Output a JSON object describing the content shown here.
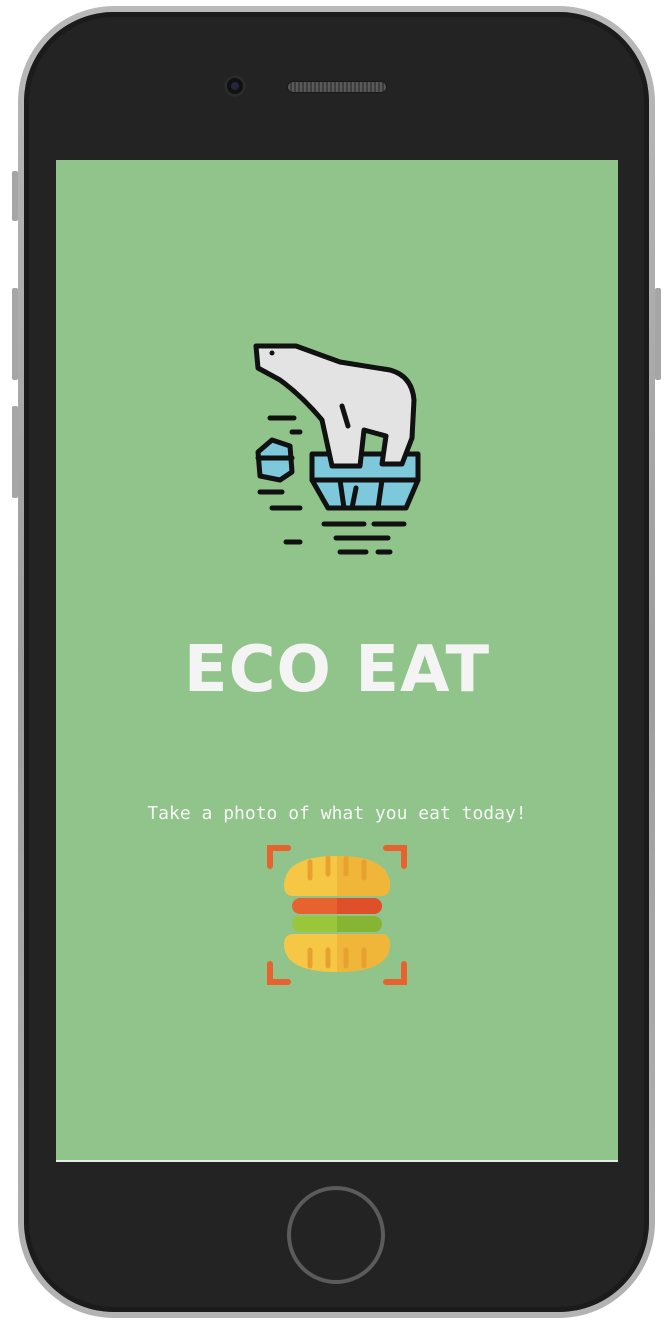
{
  "app": {
    "title": "ECO EAT",
    "tagline": "Take a photo of what you eat today!"
  },
  "icons": {
    "hero": "polar-bear-on-ice-icon",
    "scan": "burger-scan-icon",
    "home": "home-button"
  },
  "colors": {
    "screen_background": "#90c48b",
    "title_text": "#f4f4f4",
    "tagline_text": "#f6f6f6",
    "ice": "#7ec8dc",
    "bear": "#e3e3e3",
    "bun": "#f6c744",
    "tomato": "#e8622f",
    "lettuce": "#9ac63a",
    "scan_corner": "#e8622f"
  }
}
